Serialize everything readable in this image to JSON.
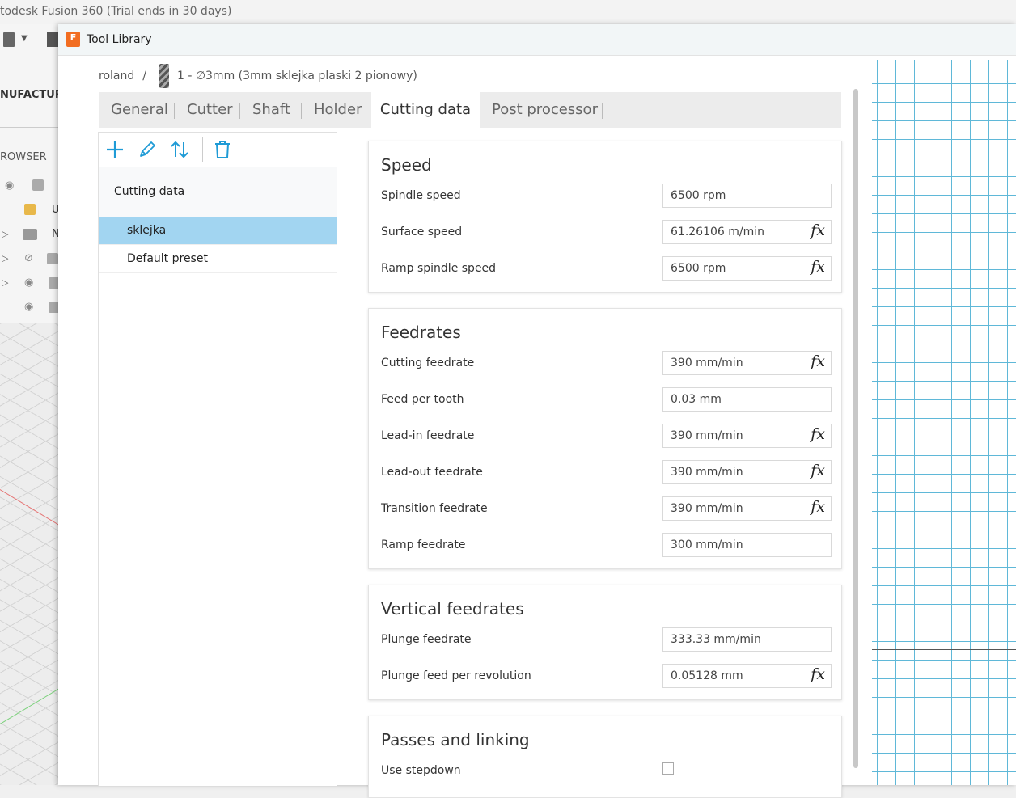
{
  "background": {
    "app_title": "todesk Fusion 360 (Trial ends in 30 days)",
    "workspace_label": "NUFACTUR",
    "browser_label": "ROWSER",
    "tree_letters": [
      "U",
      "N"
    ]
  },
  "dialog": {
    "title": "Tool Library",
    "logo": "F"
  },
  "breadcrumb": {
    "library": "roland",
    "separator": "/",
    "tool": "1 - ∅3mm (3mm sklejka plaski 2 pionowy)"
  },
  "tabs": [
    {
      "label": "General",
      "active": false
    },
    {
      "label": "Cutter",
      "active": false
    },
    {
      "label": "Shaft",
      "active": false
    },
    {
      "label": "Holder",
      "active": false
    },
    {
      "label": "Cutting data",
      "active": true
    },
    {
      "label": "Post processor",
      "active": false
    }
  ],
  "toolbar": {
    "icons": [
      "add-icon",
      "edit-icon",
      "sort-icon",
      "delete-icon"
    ],
    "accent": "#1f9bd6"
  },
  "presets": {
    "header": "Cutting data",
    "items": [
      {
        "label": "sklejka",
        "selected": true
      },
      {
        "label": "Default preset",
        "selected": false
      }
    ],
    "selected_color": "#a2d5f1"
  },
  "sections": {
    "speed": {
      "title": "Speed",
      "rows": [
        {
          "label": "Spindle speed",
          "value": "6500 rpm",
          "fx": false
        },
        {
          "label": "Surface speed",
          "value": "61.26106 m/min",
          "fx": true
        },
        {
          "label": "Ramp spindle speed",
          "value": "6500 rpm",
          "fx": true
        }
      ]
    },
    "feedrates": {
      "title": "Feedrates",
      "rows": [
        {
          "label": "Cutting feedrate",
          "value": "390 mm/min",
          "fx": true
        },
        {
          "label": "Feed per tooth",
          "value": "0.03 mm",
          "fx": false
        },
        {
          "label": "Lead-in feedrate",
          "value": "390 mm/min",
          "fx": true
        },
        {
          "label": "Lead-out feedrate",
          "value": "390 mm/min",
          "fx": true
        },
        {
          "label": "Transition feedrate",
          "value": "390 mm/min",
          "fx": true
        },
        {
          "label": "Ramp feedrate",
          "value": "300 mm/min",
          "fx": false
        }
      ]
    },
    "vertical": {
      "title": "Vertical feedrates",
      "rows": [
        {
          "label": "Plunge feedrate",
          "value": "333.33 mm/min",
          "fx": false
        },
        {
          "label": "Plunge feed per revolution",
          "value": "0.05128 mm",
          "fx": true
        }
      ]
    },
    "passes": {
      "title": "Passes and linking",
      "rows": [
        {
          "label": "Use stepdown",
          "checked": false
        }
      ]
    }
  },
  "fx_label": "fx"
}
